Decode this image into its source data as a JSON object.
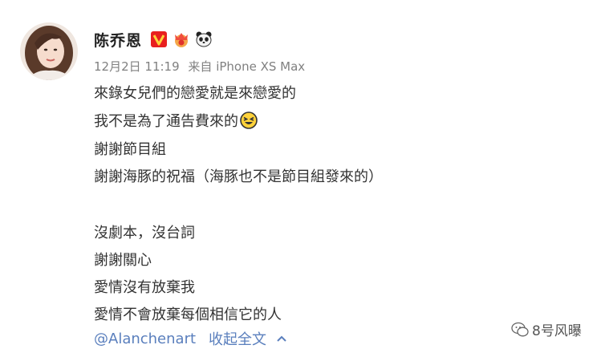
{
  "post": {
    "author": {
      "name": "陈乔恩",
      "avatar_icon": "profile-photo"
    },
    "badges": [
      "verified-v-icon",
      "crown-badge-icon",
      "panda-icon"
    ],
    "date": "12月2日 11:19",
    "source": "来自 iPhone XS Max",
    "lines": [
      "來錄女兒們的戀愛就是來戀愛的",
      "我不是為了通告費來的",
      "謝謝節目組",
      "謝謝海豚的祝福（海豚也不是節目組發來的）",
      "",
      "沒劇本，沒台詞",
      "謝謝關心",
      "愛情沒有放棄我",
      "愛情不會放棄每個相信它的人"
    ],
    "mention": "@Alanchenart",
    "collapse_label": "收起全文"
  },
  "watermark": {
    "text": "8号风曝"
  },
  "colors": {
    "link": "#5a7fbd",
    "meta": "#808080",
    "text": "#333333",
    "verified": "#e8201f"
  }
}
